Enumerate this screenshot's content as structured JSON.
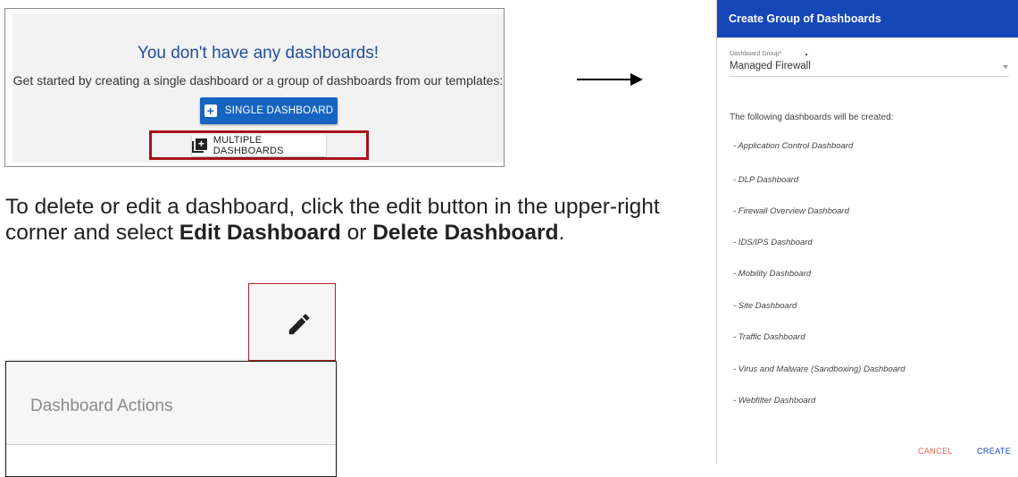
{
  "empty_state": {
    "title": "You don't have any dashboards!",
    "subtitle": "Get started by creating a single dashboard or a group of dashboards from our templates:",
    "single_button": "SINGLE DASHBOARD",
    "multiple_button": "MULTIPLE DASHBOARDS",
    "plus_icon": "plus-box-icon",
    "multi_icon": "library-add-icon"
  },
  "instructions": {
    "part1": "To delete or edit a dashboard, click the edit button in the upper-right corner and select ",
    "edit_bold": "Edit Dashboard",
    "or": " or ",
    "delete_bold": "Delete Dashboard",
    "end": "."
  },
  "edit_icon": "pencil-icon",
  "actions_panel": {
    "title": "Dashboard Actions"
  },
  "dialog": {
    "title": "Create Group of Dashboards",
    "field_label": "Dashboard Group*",
    "field_value": "Managed Firewall",
    "intro": "The following dashboards will be created:",
    "items": [
      "- Application Control Dashboard",
      "- DLP Dashboard",
      "- Firewall Overview Dashboard",
      "- IDS/IPS Dashboard",
      "- Mobility Dashboard",
      "- Site Dashboard",
      "- Traffic Dashboard",
      "- Virus and Malware (Sandboxing) Dashboard",
      "- Webfilter Dashboard"
    ],
    "cancel": "CANCEL",
    "create": "CREATE"
  },
  "colors": {
    "primary": "#1565c0",
    "dialog_header": "#1547b8",
    "highlight_border": "#a8121a",
    "cancel": "#e8604a"
  }
}
